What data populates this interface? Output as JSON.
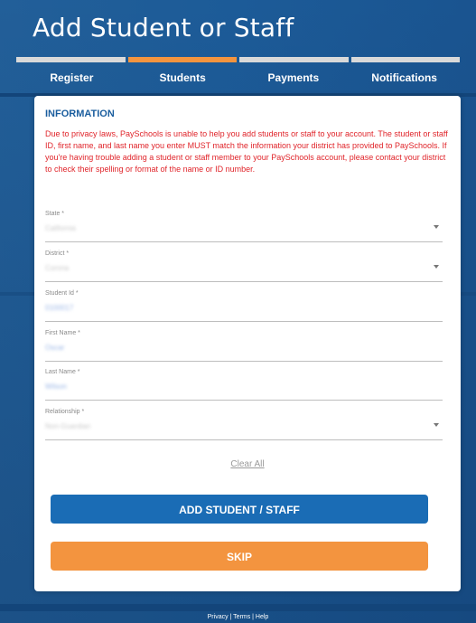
{
  "page": {
    "title": "Add Student or Staff"
  },
  "steps": {
    "tabs": [
      {
        "label": "Register",
        "active": false
      },
      {
        "label": "Students",
        "active": true
      },
      {
        "label": "Payments",
        "active": false
      },
      {
        "label": "Notifications",
        "active": false
      }
    ]
  },
  "information": {
    "heading": "INFORMATION",
    "notice": "Due to privacy laws, PaySchools is unable to help you add students or staff to your account. The student or staff ID, first name, and last name you enter MUST match the information your district has provided to PaySchools. If you're having trouble adding a student or staff member to your PaySchools account, please contact your district to check their spelling or format of the name or ID number."
  },
  "form": {
    "state": {
      "label": "State *",
      "value": "California"
    },
    "district": {
      "label": "District *",
      "value": "Corona"
    },
    "student_id": {
      "label": "Student Id *",
      "value": "0100017"
    },
    "first_name": {
      "label": "First Name *",
      "value": "Oscar"
    },
    "last_name": {
      "label": "Last Name *",
      "value": "Wilson"
    },
    "relationship": {
      "label": "Relationship *",
      "value": "Non-Guardian"
    }
  },
  "actions": {
    "clear_all": "Clear All",
    "add_button": "ADD STUDENT / STAFF",
    "skip_button": "SKIP"
  },
  "footer": {
    "links": "Privacy | Terms | Help"
  },
  "colors": {
    "accent_orange": "#f3943f",
    "primary_blue": "#1a6cb5",
    "notice_red": "#e0242a",
    "heading_blue": "#1a5d9e"
  }
}
